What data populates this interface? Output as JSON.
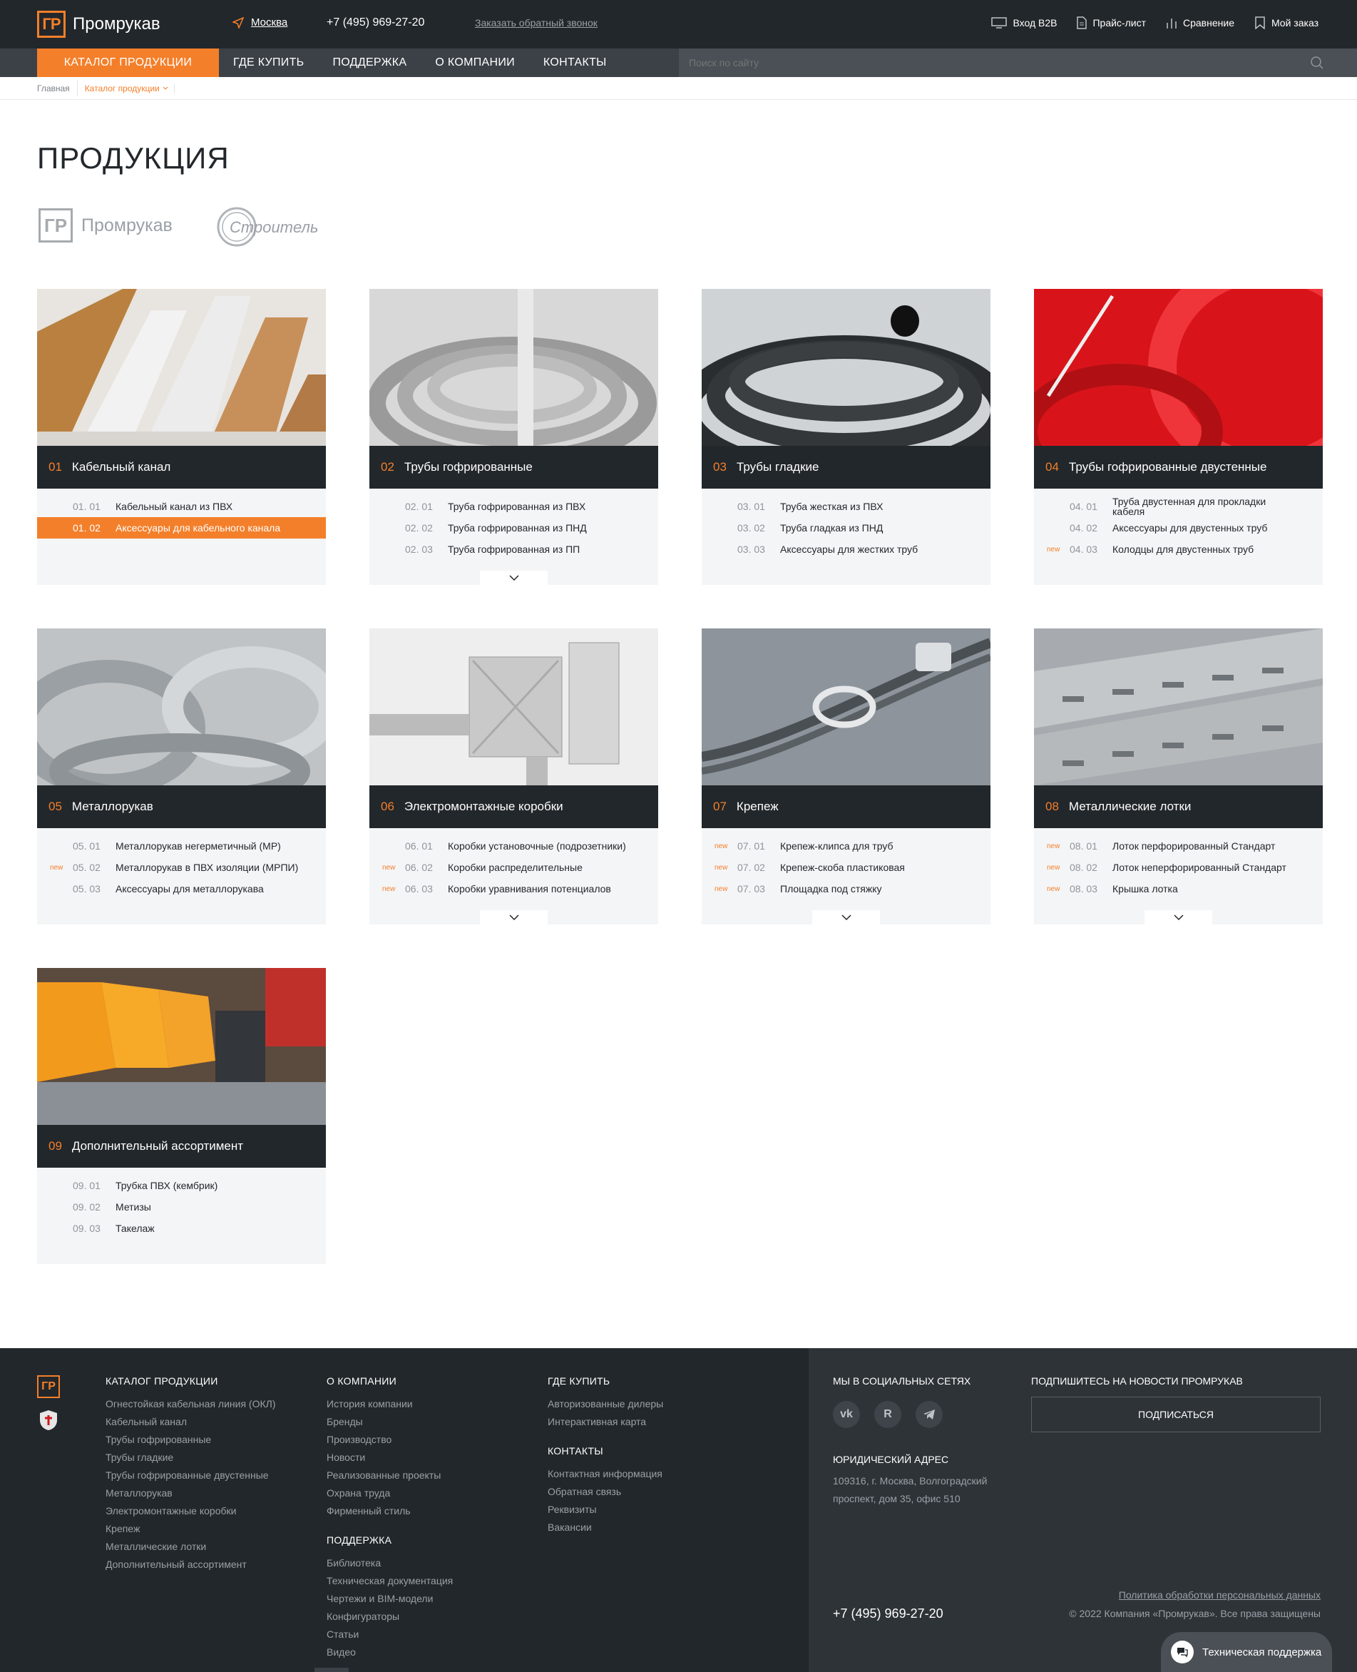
{
  "header": {
    "logo_mark": "ГР",
    "logo_text": "Промрукав",
    "city": "Москва",
    "phone": "+7 (495) 969-27-20",
    "callback": "Заказать обратный звонок",
    "links": [
      "Вход B2B",
      "Прайс-лист",
      "Сравнение",
      "Мой заказ"
    ]
  },
  "nav": {
    "items": [
      "КАТАЛОГ ПРОДУКЦИИ",
      "ГДЕ КУПИТЬ",
      "ПОДДЕРЖКА",
      "О КОМПАНИИ",
      "КОНТАКТЫ"
    ],
    "search_placeholder": "Поиск по сайту"
  },
  "breadcrumb": {
    "home": "Главная",
    "current": "Каталог продукции"
  },
  "page_title": "ПРОДУКЦИЯ",
  "brands": {
    "brand1": "Промрукав",
    "brand2": "Строитель"
  },
  "categories": [
    {
      "num": "01",
      "title": "Кабельный канал",
      "items": [
        {
          "new": "",
          "num": "01. 01",
          "label": "Кабельный канал из ПВХ"
        },
        {
          "new": "",
          "num": "01. 02",
          "label": "Аксессуары для кабельного канала"
        }
      ]
    },
    {
      "num": "02",
      "title": "Трубы гофрированные",
      "items": [
        {
          "new": "",
          "num": "02. 01",
          "label": "Труба гофрированная из ПВХ"
        },
        {
          "new": "",
          "num": "02. 02",
          "label": "Труба гофрированная из ПНД"
        },
        {
          "new": "",
          "num": "02. 03",
          "label": "Труба гофрированная из ПП"
        }
      ]
    },
    {
      "num": "03",
      "title": "Трубы гладкие",
      "items": [
        {
          "new": "",
          "num": "03. 01",
          "label": "Труба жесткая из ПВХ"
        },
        {
          "new": "",
          "num": "03. 02",
          "label": "Труба гладкая из ПНД"
        },
        {
          "new": "",
          "num": "03. 03",
          "label": "Аксессуары для жестких труб"
        }
      ]
    },
    {
      "num": "04",
      "title": "Трубы гофрированные двустенные",
      "items": [
        {
          "new": "",
          "num": "04. 01",
          "label": "Труба двустенная для прокладки кабеля"
        },
        {
          "new": "",
          "num": "04. 02",
          "label": "Аксессуары для двустенных труб"
        },
        {
          "new": "new",
          "num": "04. 03",
          "label": "Колодцы для двустенных труб"
        }
      ]
    },
    {
      "num": "05",
      "title": "Металлорукав",
      "items": [
        {
          "new": "",
          "num": "05. 01",
          "label": "Металлорукав негерметичный (МР)"
        },
        {
          "new": "new",
          "num": "05. 02",
          "label": "Металлорукав в ПВХ изоляции (МРПИ)"
        },
        {
          "new": "",
          "num": "05. 03",
          "label": "Аксессуары для металлорукава"
        }
      ]
    },
    {
      "num": "06",
      "title": "Электромонтажные коробки",
      "items": [
        {
          "new": "",
          "num": "06. 01",
          "label": "Коробки установочные (подрозетники)"
        },
        {
          "new": "new",
          "num": "06. 02",
          "label": "Коробки распределительные"
        },
        {
          "new": "new",
          "num": "06. 03",
          "label": "Коробки уравнивания потенциалов"
        }
      ]
    },
    {
      "num": "07",
      "title": "Крепеж",
      "items": [
        {
          "new": "new",
          "num": "07. 01",
          "label": "Крепеж-клипса для труб"
        },
        {
          "new": "new",
          "num": "07. 02",
          "label": "Крепеж-скоба пластиковая"
        },
        {
          "new": "new",
          "num": "07. 03",
          "label": "Площадка под стяжку"
        }
      ]
    },
    {
      "num": "08",
      "title": "Металлические лотки",
      "items": [
        {
          "new": "new",
          "num": "08. 01",
          "label": "Лоток перфорированный Стандарт"
        },
        {
          "new": "new",
          "num": "08. 02",
          "label": "Лоток неперфорированный Стандарт"
        },
        {
          "new": "new",
          "num": "08. 03",
          "label": "Крышка лотка"
        }
      ]
    },
    {
      "num": "09",
      "title": "Дополнительный ассортимент",
      "items": [
        {
          "new": "",
          "num": "09. 01",
          "label": "Трубка ПВХ (кембрик)"
        },
        {
          "new": "",
          "num": "09. 02",
          "label": "Метизы"
        },
        {
          "new": "",
          "num": "09. 03",
          "label": "Такелаж"
        }
      ]
    }
  ],
  "footer": {
    "catalog_title": "КАТАЛОГ ПРОДУКЦИИ",
    "catalog_links": [
      "Огнестойкая кабельная линия (ОКЛ)",
      "Кабельный канал",
      "Трубы гофрированные",
      "Трубы гладкие",
      "Трубы гофрированные двустенные",
      "Металлорукав",
      "Электромонтажные коробки",
      "Крепеж",
      "Металлические лотки",
      "Дополнительный ассортимент"
    ],
    "company_title": "О КОМПАНИИ",
    "company_links": [
      "История компании",
      "Бренды",
      "Производство",
      "Новости",
      "Реализованные проекты",
      "Охрана труда",
      "Фирменный стиль"
    ],
    "support_title": "ПОДДЕРЖКА",
    "support_links": [
      "Библиотека",
      "Техническая документация",
      "Чертежи и BIM-модели",
      "Конфигураторы",
      "Статьи",
      "Видео"
    ],
    "buy_title": "ГДЕ КУПИТЬ",
    "buy_links": [
      "Авторизованные дилеры",
      "Интерактивная карта"
    ],
    "contacts_title": "КОНТАКТЫ",
    "contacts_links": [
      "Контактная информация",
      "Обратная связь",
      "Реквизиты",
      "Вакансии"
    ],
    "social_title": "МЫ В СОЦИАЛЬНЫХ СЕТЯХ",
    "legal_title": "ЮРИДИЧЕСКИЙ АДРЕС",
    "address": "109316, г. Москва, Волгоградский проспект, дом 35, офис 510",
    "subscribe_title": "ПОДПИШИТЕСЬ НА НОВОСТИ ПРОМРУКАВ",
    "subscribe_button": "ПОДПИСАТЬСЯ",
    "phone": "+7 (495) 969-27-20",
    "policy": "Политика обработки персональных данных",
    "copyright": "© 2022 Компания «Промрукав». Все права защищены"
  },
  "support_widget": "Техническая поддержка",
  "colors": {
    "accent": "#f47f2a",
    "dark": "#22272b",
    "nav": "#3b4147"
  }
}
